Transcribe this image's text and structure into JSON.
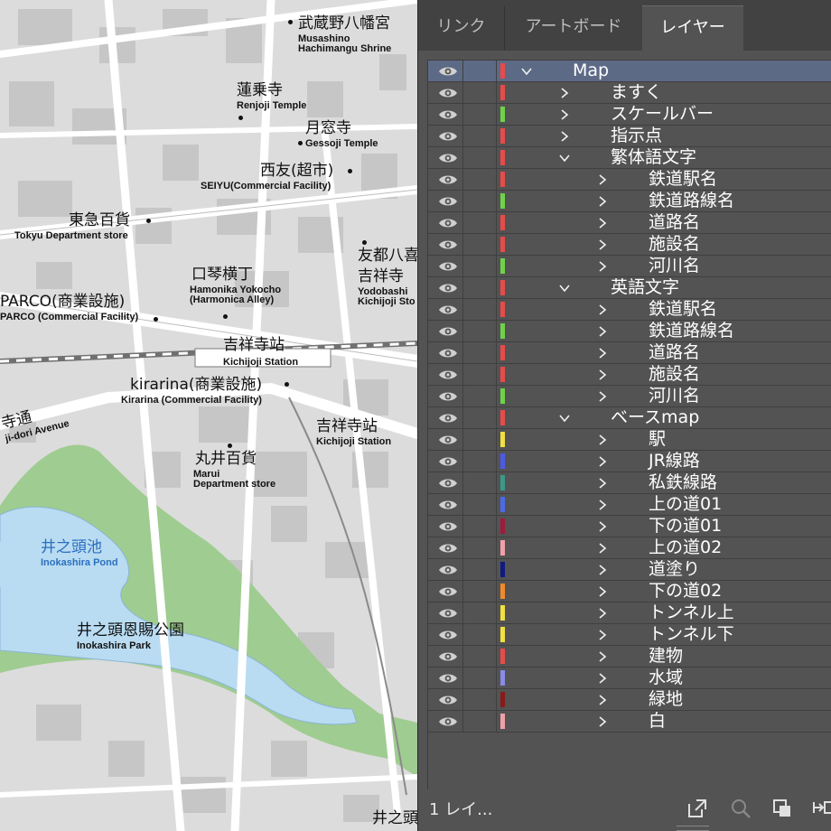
{
  "map": {
    "labels": [
      {
        "ja": "武蔵野八幡宮",
        "en": "Musashino\nHachimangu Shrine"
      },
      {
        "ja": "蓮乗寺",
        "en": "Renjoji Temple"
      },
      {
        "ja": "月窓寺",
        "en": "Gessoji Temple"
      },
      {
        "ja": "西友(超市)",
        "en": "SEIYU(Commercial Facility)"
      },
      {
        "ja": "東急百貨",
        "en": "Tokyu Department store"
      },
      {
        "ja": "友都八喜",
        "en": ""
      },
      {
        "ja": "吉祥寺",
        "en": "Yodobashi\nKichijoji Sto"
      },
      {
        "ja": "口琴横丁",
        "en": "Hamonika Yokocho\n(Harmonica Alley)"
      },
      {
        "ja": "PARCO(商業設施)",
        "en": "PARCO (Commercial Facility)"
      },
      {
        "ja": "吉祥寺站",
        "en": "Kichijoji Station"
      },
      {
        "ja": "kirarina(商業設施)",
        "en": "Kirarina (Commercial Facility)"
      },
      {
        "ja": "吉祥寺站",
        "en": "Kichijoji Station"
      },
      {
        "ja": "寺通",
        "en": "ji-dori Avenue"
      },
      {
        "ja": "丸井百貨",
        "en": "Marui\nDepartment store"
      },
      {
        "ja": "井之頭池",
        "en": "Inokashira Pond"
      },
      {
        "ja": "井之頭恩賜公園",
        "en": "Inokashira Park"
      },
      {
        "ja": "井之頭",
        "en": ""
      }
    ]
  },
  "panel": {
    "tabs": [
      {
        "label": "リンク",
        "active": false
      },
      {
        "label": "アートボード",
        "active": false
      },
      {
        "label": "レイヤー",
        "active": true
      }
    ],
    "layers": [
      {
        "name": "Map",
        "level": 0,
        "expanded": true,
        "color": "#e84a4a",
        "selected": true
      },
      {
        "name": "ますく",
        "level": 1,
        "expanded": false,
        "color": "#e84a4a"
      },
      {
        "name": "スケールバー",
        "level": 1,
        "expanded": false,
        "color": "#6fd24a"
      },
      {
        "name": "指示点",
        "level": 1,
        "expanded": false,
        "color": "#e84a4a"
      },
      {
        "name": "繁体語文字",
        "level": 1,
        "expanded": true,
        "color": "#e84a4a"
      },
      {
        "name": "鉄道駅名",
        "level": 2,
        "expanded": false,
        "color": "#e84a4a"
      },
      {
        "name": "鉄道路線名",
        "level": 2,
        "expanded": false,
        "color": "#6fd24a"
      },
      {
        "name": "道路名",
        "level": 2,
        "expanded": false,
        "color": "#e84a4a"
      },
      {
        "name": "施設名",
        "level": 2,
        "expanded": false,
        "color": "#e84a4a"
      },
      {
        "name": "河川名",
        "level": 2,
        "expanded": false,
        "color": "#6fd24a"
      },
      {
        "name": "英語文字",
        "level": 1,
        "expanded": true,
        "color": "#e84a4a"
      },
      {
        "name": "鉄道駅名",
        "level": 2,
        "expanded": false,
        "color": "#e84a4a"
      },
      {
        "name": "鉄道路線名",
        "level": 2,
        "expanded": false,
        "color": "#6fd24a"
      },
      {
        "name": "道路名",
        "level": 2,
        "expanded": false,
        "color": "#e84a4a"
      },
      {
        "name": "施設名",
        "level": 2,
        "expanded": false,
        "color": "#e84a4a"
      },
      {
        "name": "河川名",
        "level": 2,
        "expanded": false,
        "color": "#6fd24a"
      },
      {
        "name": "ベースmap",
        "level": 1,
        "expanded": true,
        "color": "#e84a4a"
      },
      {
        "name": "駅",
        "level": 2,
        "expanded": false,
        "color": "#f0e040"
      },
      {
        "name": "JR線路",
        "level": 2,
        "expanded": false,
        "color": "#4a5ae8"
      },
      {
        "name": "私鉄線路",
        "level": 2,
        "expanded": false,
        "color": "#3a9a8a"
      },
      {
        "name": "上の道01",
        "level": 2,
        "expanded": false,
        "color": "#4a6ae8"
      },
      {
        "name": "下の道01",
        "level": 2,
        "expanded": false,
        "color": "#a01a3a"
      },
      {
        "name": "上の道02",
        "level": 2,
        "expanded": false,
        "color": "#f0a0a8"
      },
      {
        "name": "道塗り",
        "level": 2,
        "expanded": false,
        "color": "#101a80"
      },
      {
        "name": "下の道02",
        "level": 2,
        "expanded": false,
        "color": "#f08a2a"
      },
      {
        "name": "トンネル上",
        "level": 2,
        "expanded": false,
        "color": "#f0e040"
      },
      {
        "name": "トンネル下",
        "level": 2,
        "expanded": false,
        "color": "#f0e040"
      },
      {
        "name": "建物",
        "level": 2,
        "expanded": false,
        "color": "#e84a4a"
      },
      {
        "name": "水域",
        "level": 2,
        "expanded": false,
        "color": "#8a8ae8"
      },
      {
        "name": "緑地",
        "level": 2,
        "expanded": false,
        "color": "#8a1a1a"
      },
      {
        "name": "白",
        "level": 2,
        "expanded": false,
        "color": "#f0a0a8"
      }
    ],
    "footer": {
      "count_label": "1 レイ...",
      "icons": [
        "export-icon",
        "search-icon",
        "clip-icon",
        "new-layer-icon"
      ]
    }
  }
}
